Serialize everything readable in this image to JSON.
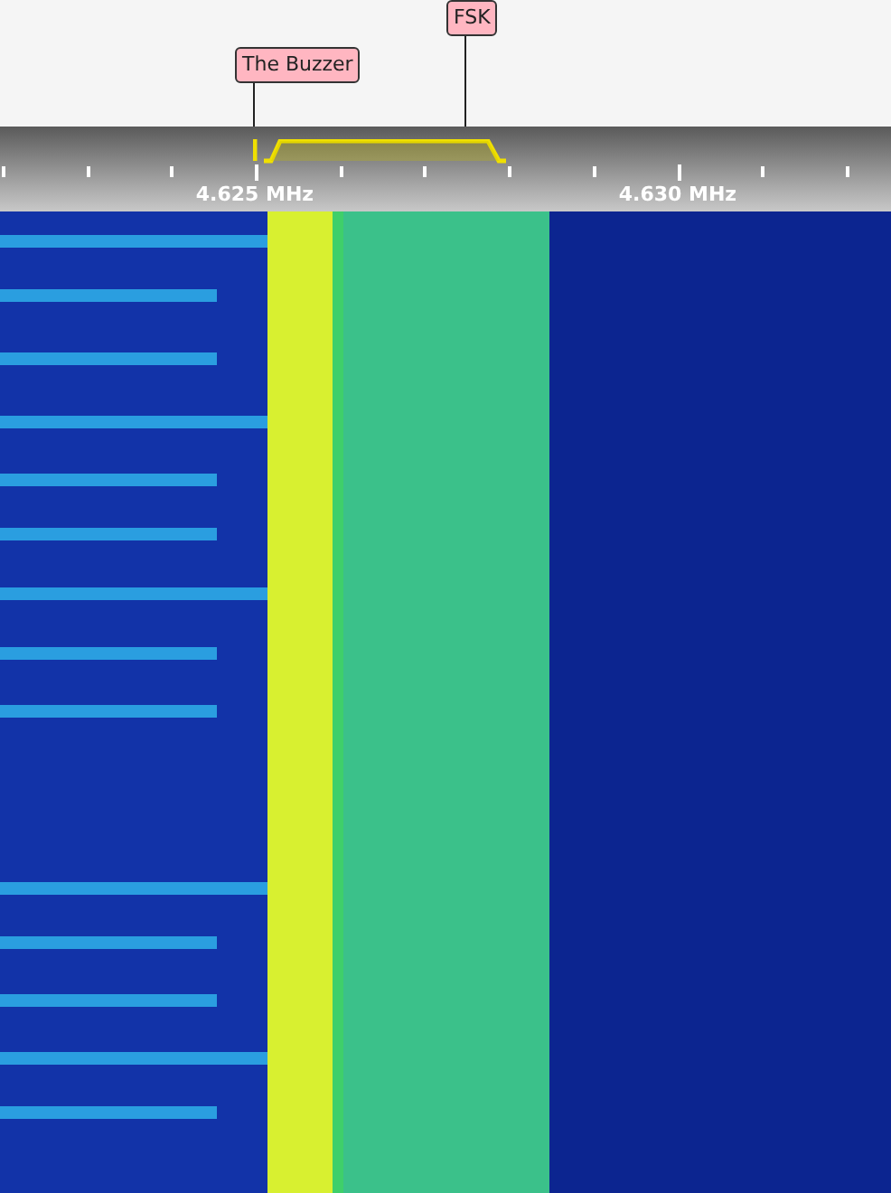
{
  "bookmarks": [
    {
      "label": "The Buzzer"
    },
    {
      "label": "FSK"
    }
  ],
  "scale": {
    "labels": [
      "4.625 MHz",
      "4.630 MHz"
    ]
  }
}
